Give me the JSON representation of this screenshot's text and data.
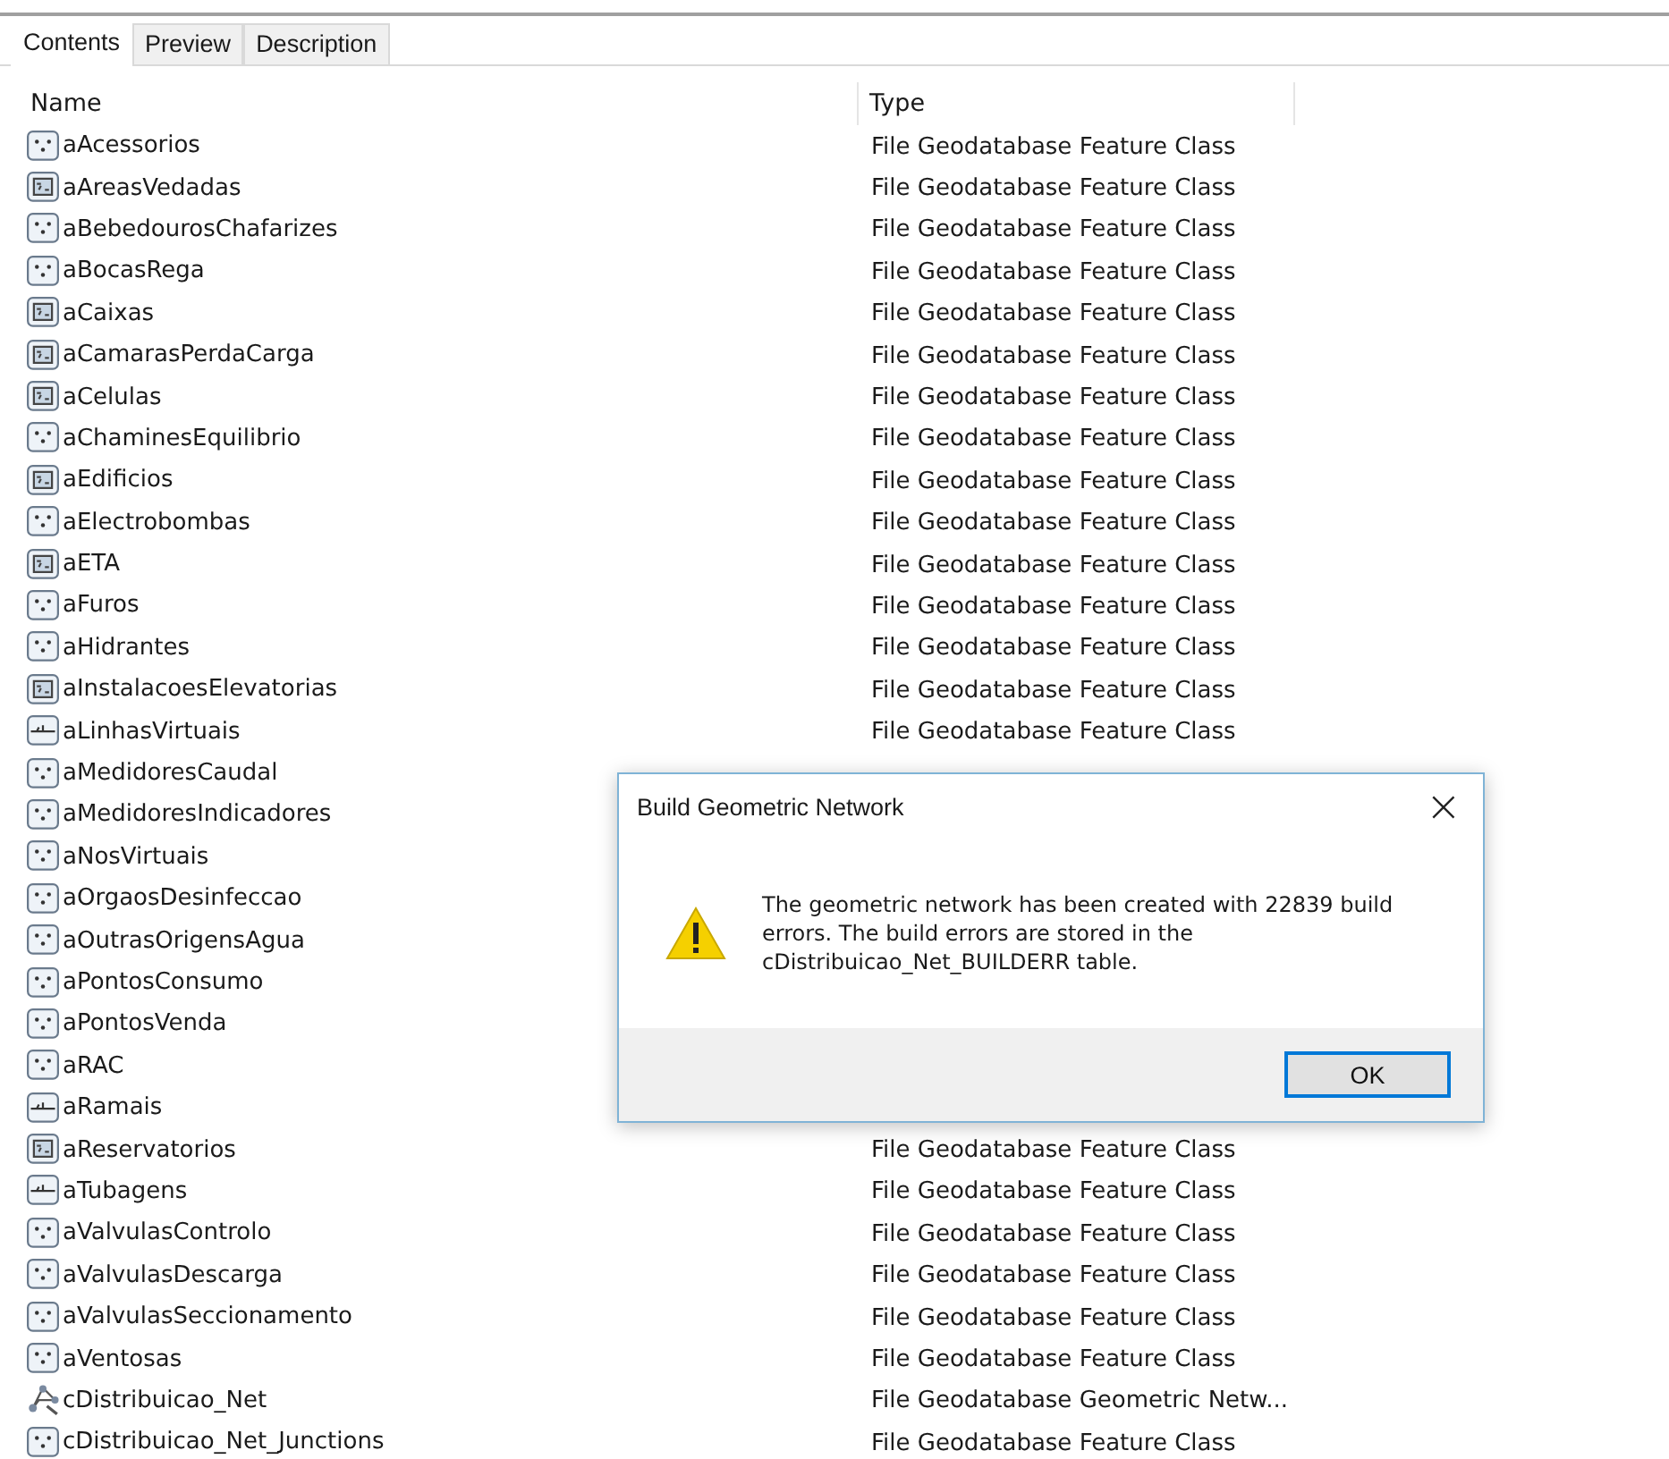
{
  "tabs": [
    {
      "label": "Contents",
      "selected": true
    },
    {
      "label": "Preview",
      "selected": false
    },
    {
      "label": "Description",
      "selected": false
    }
  ],
  "columns": [
    "Name",
    "Type"
  ],
  "rows": [
    {
      "name": "aAcessorios",
      "kind": "point",
      "type": "File Geodatabase Feature Class"
    },
    {
      "name": "aAreasVedadas",
      "kind": "polygon",
      "type": "File Geodatabase Feature Class"
    },
    {
      "name": "aBebedourosChafarizes",
      "kind": "point",
      "type": "File Geodatabase Feature Class"
    },
    {
      "name": "aBocasRega",
      "kind": "point",
      "type": "File Geodatabase Feature Class"
    },
    {
      "name": "aCaixas",
      "kind": "polygon",
      "type": "File Geodatabase Feature Class"
    },
    {
      "name": "aCamarasPerdaCarga",
      "kind": "polygon",
      "type": "File Geodatabase Feature Class"
    },
    {
      "name": "aCelulas",
      "kind": "polygon",
      "type": "File Geodatabase Feature Class"
    },
    {
      "name": "aChaminesEquilibrio",
      "kind": "point",
      "type": "File Geodatabase Feature Class"
    },
    {
      "name": "aEdificios",
      "kind": "polygon",
      "type": "File Geodatabase Feature Class"
    },
    {
      "name": "aElectrobombas",
      "kind": "point",
      "type": "File Geodatabase Feature Class"
    },
    {
      "name": "aETA",
      "kind": "polygon",
      "type": "File Geodatabase Feature Class"
    },
    {
      "name": "aFuros",
      "kind": "point",
      "type": "File Geodatabase Feature Class"
    },
    {
      "name": "aHidrantes",
      "kind": "point",
      "type": "File Geodatabase Feature Class"
    },
    {
      "name": "aInstalacoesElevatorias",
      "kind": "polygon",
      "type": "File Geodatabase Feature Class"
    },
    {
      "name": "aLinhasVirtuais",
      "kind": "line",
      "type": "File Geodatabase Feature Class"
    },
    {
      "name": "aMedidoresCaudal",
      "kind": "point"
    },
    {
      "name": "aMedidoresIndicadores",
      "kind": "point"
    },
    {
      "name": "aNosVirtuais",
      "kind": "point"
    },
    {
      "name": "aOrgaosDesinfeccao",
      "kind": "point"
    },
    {
      "name": "aOutrasOrigensAgua",
      "kind": "point"
    },
    {
      "name": "aPontosConsumo",
      "kind": "point"
    },
    {
      "name": "aPontosVenda",
      "kind": "point"
    },
    {
      "name": "aRAC",
      "kind": "point"
    },
    {
      "name": "aRamais",
      "kind": "line"
    },
    {
      "name": "aReservatorios",
      "kind": "polygon",
      "type": "File Geodatabase Feature Class"
    },
    {
      "name": "aTubagens",
      "kind": "line",
      "type": "File Geodatabase Feature Class"
    },
    {
      "name": "aValvulasControlo",
      "kind": "point",
      "type": "File Geodatabase Feature Class"
    },
    {
      "name": "aValvulasDescarga",
      "kind": "point",
      "type": "File Geodatabase Feature Class"
    },
    {
      "name": "aValvulasSeccionamento",
      "kind": "point",
      "type": "File Geodatabase Feature Class"
    },
    {
      "name": "aVentosas",
      "kind": "point",
      "type": "File Geodatabase Feature Class"
    },
    {
      "name": "cDistribuicao_Net",
      "kind": "network",
      "type": "File Geodatabase Geometric Netw..."
    },
    {
      "name": "cDistribuicao_Net_Junctions",
      "kind": "point",
      "type": "File Geodatabase Feature Class"
    }
  ],
  "dialog": {
    "title": "Build Geometric Network",
    "close": "×",
    "message": "The geometric network has been created with 22839 build errors. The build errors are stored in the cDistribuicao_Net_BUILDERR table.",
    "button": "OK"
  }
}
